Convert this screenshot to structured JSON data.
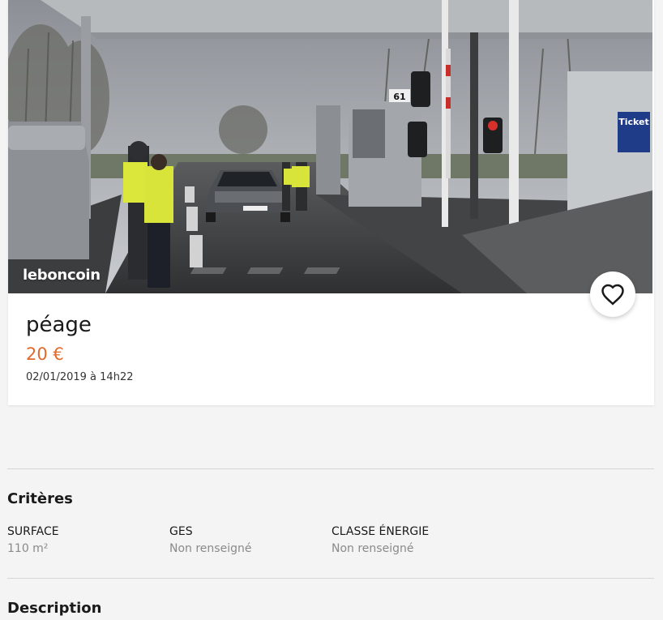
{
  "ad": {
    "title": "péage",
    "price": "20 €",
    "date": "02/01/2019 à 14h22"
  },
  "photo": {
    "watermark": "leboncoin",
    "booth_number": "61",
    "sign_text": "Ticket"
  },
  "criteria": {
    "heading": "Critères",
    "items": [
      {
        "label": "SURFACE",
        "value": "110 m²"
      },
      {
        "label": "GES",
        "value": "Non renseigné"
      },
      {
        "label": "CLASSE ÉNERGIE",
        "value": "Non renseigné"
      }
    ]
  },
  "description": {
    "heading": "Description"
  },
  "icons": {
    "favorite": "heart-icon"
  },
  "colors": {
    "price": "#e1692c",
    "background": "#f4f4f4"
  }
}
